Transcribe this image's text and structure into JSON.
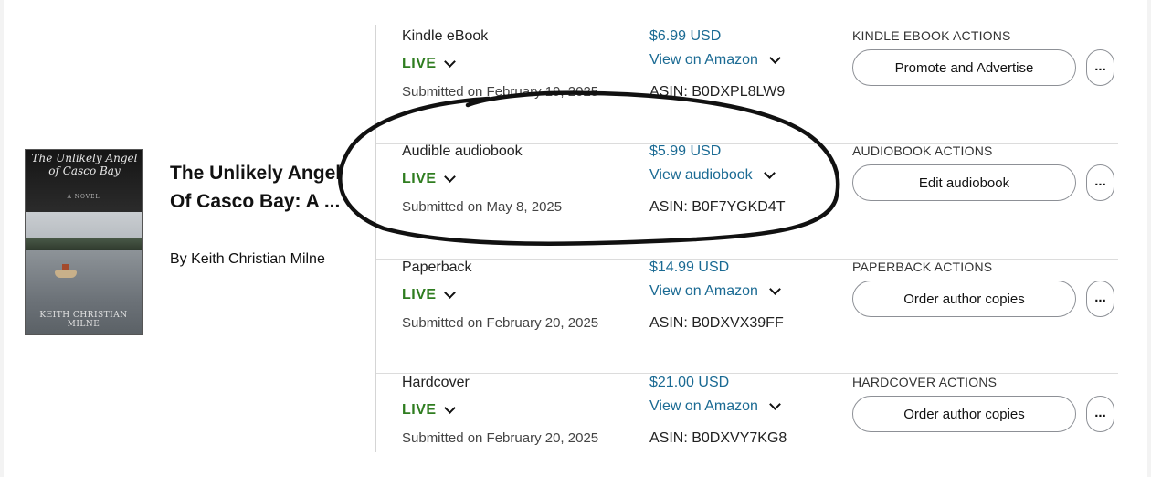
{
  "book": {
    "cover": {
      "title": "The Unlikely Angel of Casco Bay",
      "subtitle": "A NOVEL",
      "author": "KEITH CHRISTIAN MILNE"
    },
    "title": "The Unlikely Angel Of Casco Bay: A ...",
    "author": "By Keith Christian Milne"
  },
  "formats": [
    {
      "name": "Kindle eBook",
      "status": "LIVE",
      "submitted": "Submitted on February 19, 2025",
      "price": "$6.99 USD",
      "view_link": "View on Amazon",
      "asin": "ASIN: B0DXPL8LW9",
      "actions_title": "KINDLE EBOOK ACTIONS",
      "action_label": "Promote and Advertise",
      "more_label": "..."
    },
    {
      "name": "Audible audiobook",
      "status": "LIVE",
      "submitted": "Submitted on May 8, 2025",
      "price": "$5.99 USD",
      "view_link": "View audiobook",
      "asin": "ASIN: B0F7YGKD4T",
      "actions_title": "AUDIOBOOK ACTIONS",
      "action_label": "Edit audiobook",
      "more_label": "..."
    },
    {
      "name": "Paperback",
      "status": "LIVE",
      "submitted": "Submitted on February 20, 2025",
      "price": "$14.99 USD",
      "view_link": "View on Amazon",
      "asin": "ASIN: B0DXVX39FF",
      "actions_title": "PAPERBACK ACTIONS",
      "action_label": "Order author copies",
      "more_label": "..."
    },
    {
      "name": "Hardcover",
      "status": "LIVE",
      "submitted": "Submitted on February 20, 2025",
      "price": "$21.00 USD",
      "view_link": "View on Amazon",
      "asin": "ASIN: B0DXVY7KG8",
      "actions_title": "HARDCOVER ACTIONS",
      "action_label": "Order author copies",
      "more_label": "..."
    }
  ],
  "colors": {
    "live_green": "#2f7d20",
    "link_blue": "#1a6a93"
  }
}
